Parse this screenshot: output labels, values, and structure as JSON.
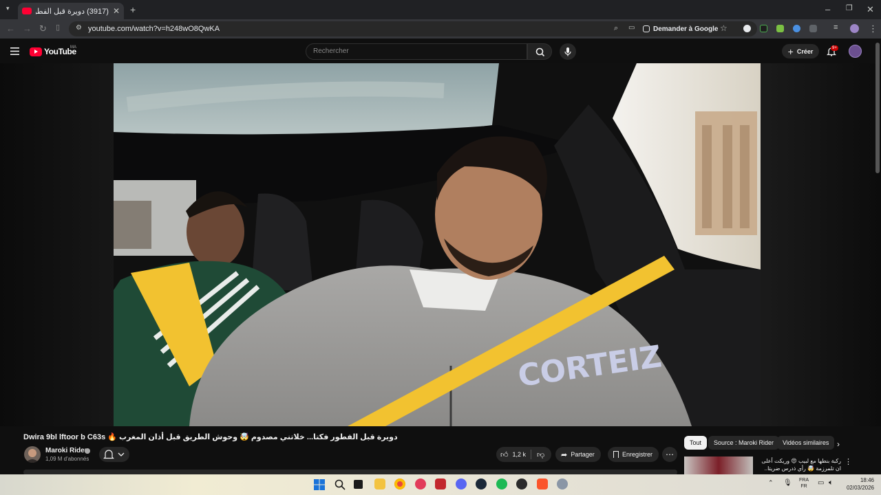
{
  "browser": {
    "tab_title": "(3917) دويرة قبل الفطور فكتا...",
    "url": "youtube.com/watch?v=h248wO8QwKA",
    "ask_google": "Demander à Google"
  },
  "youtube": {
    "logo_text": "YouTube",
    "region": "MA",
    "search_placeholder": "Rechercher",
    "create_label": "Créer",
    "notif_count": "9+"
  },
  "video": {
    "title": "Dwira 9bl lftoor b C63s 🔥 دويرة قبل الفطور فكتا... خلاتني مصدوم 🤯 وحوش الطريق قبل أذان المغرب",
    "channel": "Maroki Rider",
    "subscribers": "1,09 M d'abonnés",
    "likes": "1,2 k",
    "share_label": "Partager",
    "save_label": "Enregistrer"
  },
  "chips": [
    "Tout",
    "Source : Maroki Rider",
    "Vidéos similaires"
  ],
  "recommendation": {
    "title_line1": "ركبة بنطها مع لبيب 😍 وريكت أعلى",
    "title_line2": "ان تلمرزمة 🤯 رأي ذدرس ضريتا.."
  },
  "taskbar": {
    "lang_line1": "FRA",
    "lang_line2": "FR",
    "time": "18:46",
    "date": "02/03/2026"
  },
  "colors": {
    "youtube_red": "#ff0033",
    "belt_yellow": "#f2c230",
    "background": "#0f0f0f"
  }
}
